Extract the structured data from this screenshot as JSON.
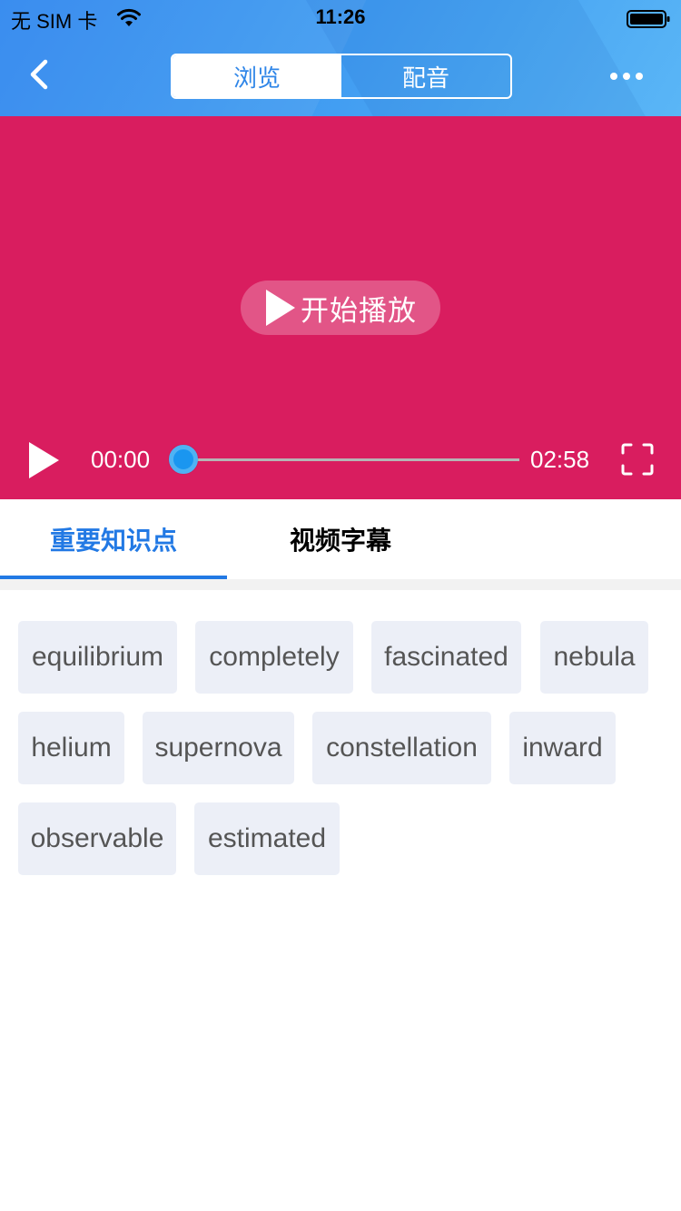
{
  "status_bar": {
    "carrier": "无 SIM 卡",
    "time": "11:26"
  },
  "header": {
    "back_icon": "chevron-left-icon",
    "segments": [
      {
        "label": "浏览",
        "active": true
      },
      {
        "label": "配音",
        "active": false
      }
    ],
    "more_icon": "more-dots-icon",
    "accent_color": "#2f86e8"
  },
  "video": {
    "background_color": "#d91d5f",
    "start_play_label": "开始播放",
    "current_time": "00:00",
    "total_time": "02:58",
    "progress_fraction": 0,
    "fullscreen_icon": "fullscreen-icon"
  },
  "tabs": [
    {
      "label": "重要知识点",
      "active": true
    },
    {
      "label": "视频字幕",
      "active": false
    }
  ],
  "keywords": [
    "equilibrium",
    "completely",
    "fascinated",
    "nebula",
    "helium",
    "supernova",
    "constellation",
    "inward",
    "observable",
    "estimated"
  ]
}
